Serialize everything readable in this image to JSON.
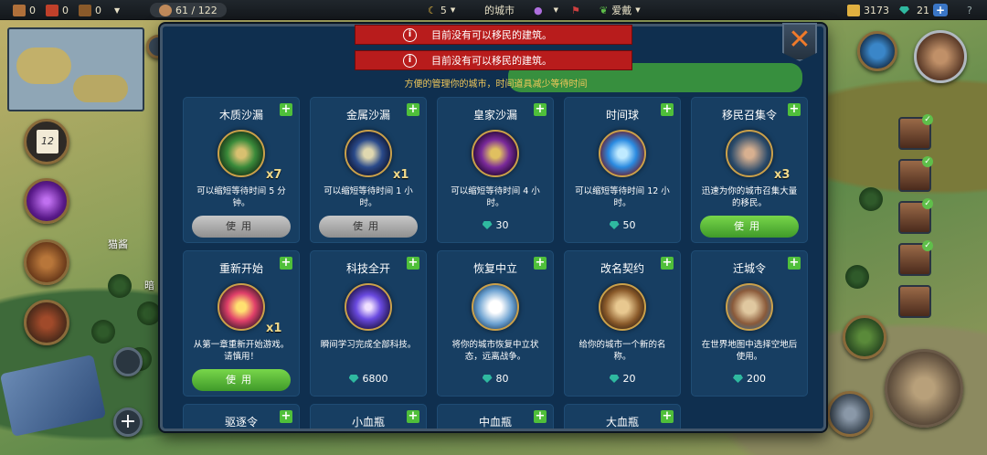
{
  "topbar": {
    "res1": "0",
    "res2": "0",
    "res3": "0",
    "population": "61 / 122",
    "turns": "5",
    "city_label": "的城市",
    "ruler_label": "爱戴",
    "gold": "3173",
    "gems": "21",
    "plus": "+",
    "help": "?"
  },
  "map": {
    "label1": "猫酱",
    "label2": "暗"
  },
  "dialog": {
    "subtitle": "方便的管理你的城市，时间道具减少等待时间",
    "alerts": [
      "目前没有可以移民的建筑。",
      "目前没有可以移民的建筑。"
    ],
    "close_glyph": "✕",
    "items": [
      {
        "name": "木质沙漏",
        "count": "x7",
        "desc": "可以缩短等待时间 5 分钟。",
        "button": "使用",
        "button_style": "gray"
      },
      {
        "name": "金属沙漏",
        "count": "x1",
        "desc": "可以缩短等待时间 1 小时。",
        "button": "使用",
        "button_style": "gray"
      },
      {
        "name": "皇家沙漏",
        "desc": "可以缩短等待时间 4 小时。",
        "price": "30"
      },
      {
        "name": "时间球",
        "desc": "可以缩短等待时间 12 小时。",
        "price": "50"
      },
      {
        "name": "移民召集令",
        "count": "x3",
        "desc": "迅速为你的城市召集大量的移民。",
        "button": "使用",
        "button_style": "green"
      },
      {
        "name": "重新开始",
        "count": "x1",
        "desc": "从第一章重新开始游戏。请慎用！",
        "button": "使用",
        "button_style": "green"
      },
      {
        "name": "科技全开",
        "desc": "瞬间学习完成全部科技。",
        "price": "6800"
      },
      {
        "name": "恢复中立",
        "desc": "将你的城市恢复中立状态，远离战争。",
        "price": "80"
      },
      {
        "name": "改名契约",
        "desc": "给你的城市一个新的名称。",
        "price": "20"
      },
      {
        "name": "迁城令",
        "desc": "在世界地图中选择空地后使用。",
        "price": "200"
      },
      {
        "name": "驱逐令"
      },
      {
        "name": "小血瓶"
      },
      {
        "name": "中血瓶"
      },
      {
        "name": "大血瓶"
      }
    ],
    "plus_glyph": "+"
  },
  "hud": {
    "calendar_day": "12",
    "add_glyph": "+"
  },
  "colors": {
    "panel": "#0f2f4f",
    "card": "#173e62",
    "alert": "#b81c1c",
    "subtitle": "#f0c85a",
    "plus": "#4fbf3a"
  }
}
